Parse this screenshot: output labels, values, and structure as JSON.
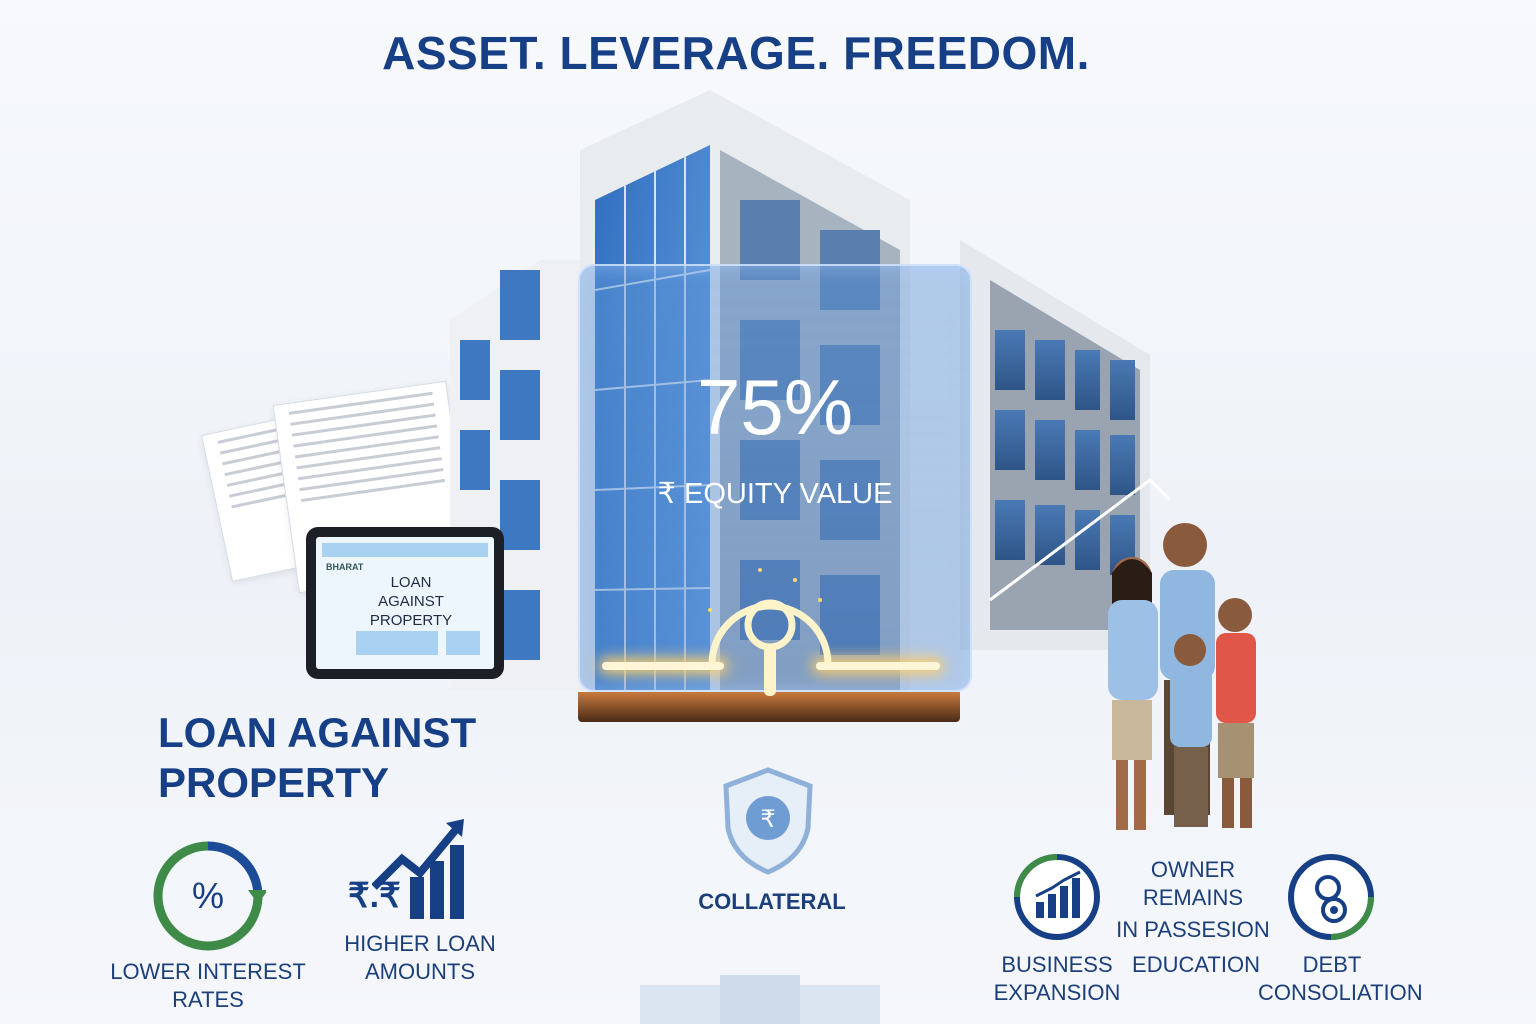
{
  "headline": "ASSET. LEVERAGE. FREEDOM.",
  "tablet": {
    "brand": "BHARAT",
    "text": "LOAN AGAINST PROPERTY"
  },
  "panel": {
    "percent": "75%",
    "equity": "₹ EQUITY VALUE"
  },
  "section_title": [
    "LOAN AGAINST",
    "PROPERTY"
  ],
  "benefits": {
    "rates": "LOWER INTEREST RATES",
    "amounts": [
      "HIGHER LOAN",
      "AMOUNTS"
    ],
    "rupee_pair": "₹.₹"
  },
  "collateral": {
    "label": "COLLATERAL",
    "symbol": "₹"
  },
  "uses": {
    "owner": [
      "OWNER REMAINS",
      "IN PASSESION"
    ],
    "business": [
      "BUSINESS",
      "EXPANSION"
    ],
    "education": "EDUCATION",
    "debt": [
      "DEBT",
      "CONSOLIATION"
    ]
  },
  "colors": {
    "navy": "#173f86",
    "green": "#3e8b48",
    "glass": "#4f8ed6",
    "glow": "#ffcf6a"
  },
  "icons": [
    "percent-cycle-icon",
    "growth-chart-icon",
    "shield-rupee-icon",
    "bar-chart-icon",
    "coins-icon"
  ]
}
